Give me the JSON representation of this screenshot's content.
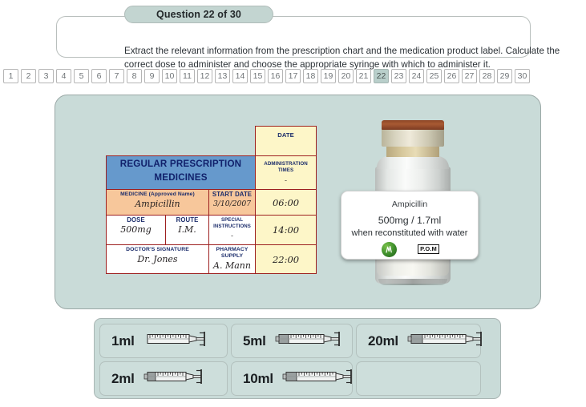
{
  "question_header": {
    "tab_label": "Question 22 of 30",
    "instruction": "Extract the relevant information from the prescription chart and the medication product label. Calculate the correct dose to administer and choose the appropriate syringe with which to administer it."
  },
  "pager": {
    "current": "22",
    "items": [
      "1",
      "2",
      "3",
      "4",
      "5",
      "6",
      "7",
      "8",
      "9",
      "10",
      "11",
      "12",
      "13",
      "14",
      "15",
      "16",
      "17",
      "18",
      "19",
      "20",
      "21",
      "22",
      "23",
      "24",
      "25",
      "26",
      "27",
      "28",
      "29",
      "30"
    ]
  },
  "prescription_chart": {
    "date_header": "DATE",
    "main_header_line1": "REGULAR PRESCRIPTION",
    "main_header_line2": "MEDICINES",
    "administration_times_label": "ADMINISTRATION TIMES",
    "administration_times_value": "-",
    "medicine_label": "MEDICINE (Approved Name)",
    "medicine_value": "Ampicillin",
    "start_date_label": "START DATE",
    "start_date_value": "3/10/2007",
    "dose_label": "DOSE",
    "dose_value": "500mg",
    "route_label": "ROUTE",
    "route_value": "I.M.",
    "special_instructions_label_line1": "SPECIAL",
    "special_instructions_label_line2": "INSTRUCTIONS",
    "special_instructions_value": "-",
    "doctors_signature_label": "DOCTOR'S SIGNATURE",
    "doctors_signature_value": "Dr. Jones",
    "pharmacy_supply_label": "PHARMACY SUPPLY",
    "pharmacy_supply_value": "A. Mann",
    "times": [
      "06:00",
      "14:00",
      "22:00"
    ]
  },
  "product_label": {
    "drug_name": "Ampicillin",
    "strength": "500mg / 1.7ml",
    "reconstitution": "when reconstituted with water",
    "logo_icon": "green-leaf-logo-icon",
    "pom_badge": "P.O.M"
  },
  "vial": {
    "icon": "medication-vial-icon"
  },
  "syringe_options": [
    {
      "label": "1ml",
      "icon": "syringe-icon",
      "size": "small"
    },
    {
      "label": "5ml",
      "icon": "syringe-icon",
      "size": "medium"
    },
    {
      "label": "20ml",
      "icon": "syringe-icon",
      "size": "large"
    },
    {
      "label": "2ml",
      "icon": "syringe-icon",
      "size": "small2"
    },
    {
      "label": "10ml",
      "icon": "syringe-icon",
      "size": "medium2"
    }
  ],
  "colors": {
    "panel_bg": "#c9dbd8",
    "tab_bg": "#c3d5d1",
    "chart_header_blue": "#6699cc",
    "chart_border_red": "#9d2020",
    "chart_peach": "#f7c79b",
    "chart_cream": "#fdf6c8",
    "label_navy": "#11216b",
    "pager_current_bg": "#b9cfcb"
  }
}
